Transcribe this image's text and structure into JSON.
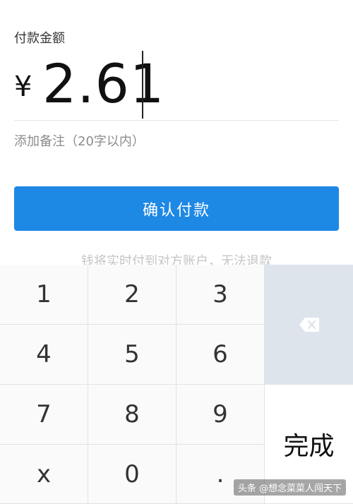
{
  "payment": {
    "label": "付款金额",
    "currency_symbol": "¥",
    "amount": "2.61",
    "remark_placeholder": "添加备注（20字以内）",
    "confirm_label": "确认付款",
    "notice": "钱将实时付到对方账户，无法退款"
  },
  "keypad": {
    "keys": [
      "1",
      "2",
      "3",
      "4",
      "5",
      "6",
      "7",
      "8",
      "9",
      "x",
      "0",
      "."
    ],
    "delete_icon": "backspace-icon",
    "done_label": "完成"
  },
  "watermark": "头条 @想念菜菜人闯天下",
  "colors": {
    "primary_button": "#1e88e5",
    "delete_key_bg": "#dde4ec"
  }
}
